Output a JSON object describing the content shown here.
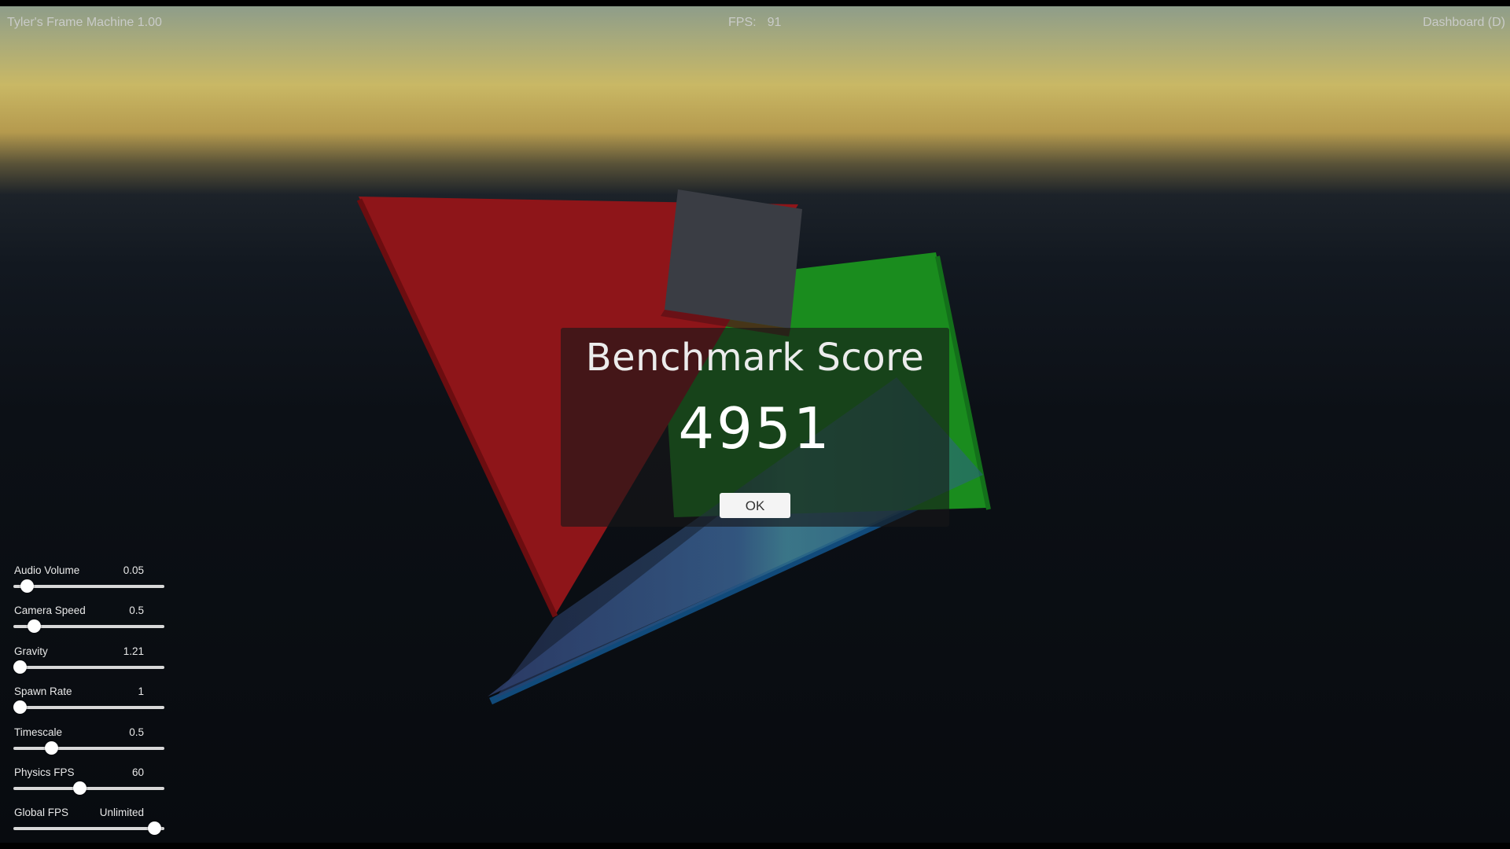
{
  "app": {
    "title": "Tyler's Frame Machine 1.00",
    "fps_label": "FPS:",
    "fps_value": "91",
    "dashboard_link": "Dashboard (D)"
  },
  "dialog": {
    "title": "Benchmark Score",
    "score": "4951",
    "ok_label": "OK"
  },
  "scene": {
    "objects": [
      {
        "name": "red-triangle",
        "color": "#8e1519"
      },
      {
        "name": "green-panel",
        "color": "#1a8c1e"
      },
      {
        "name": "gray-cube",
        "color": "#3a3d44"
      },
      {
        "name": "blue-triangle",
        "color": "#2f5f8a"
      }
    ]
  },
  "settings": {
    "sliders": [
      {
        "label": "Audio Volume",
        "value": "0.05",
        "fill": 0.05
      },
      {
        "label": "Camera Speed",
        "value": "0.5",
        "fill": 0.1
      },
      {
        "label": "Gravity",
        "value": "1.21",
        "fill": 0.0
      },
      {
        "label": "Spawn Rate",
        "value": "1",
        "fill": 0.0
      },
      {
        "label": "Timescale",
        "value": "0.5",
        "fill": 0.23
      },
      {
        "label": "Physics FPS",
        "value": "60",
        "fill": 0.43
      },
      {
        "label": "Global FPS",
        "value": "Unlimited",
        "fill": 0.97
      }
    ]
  }
}
